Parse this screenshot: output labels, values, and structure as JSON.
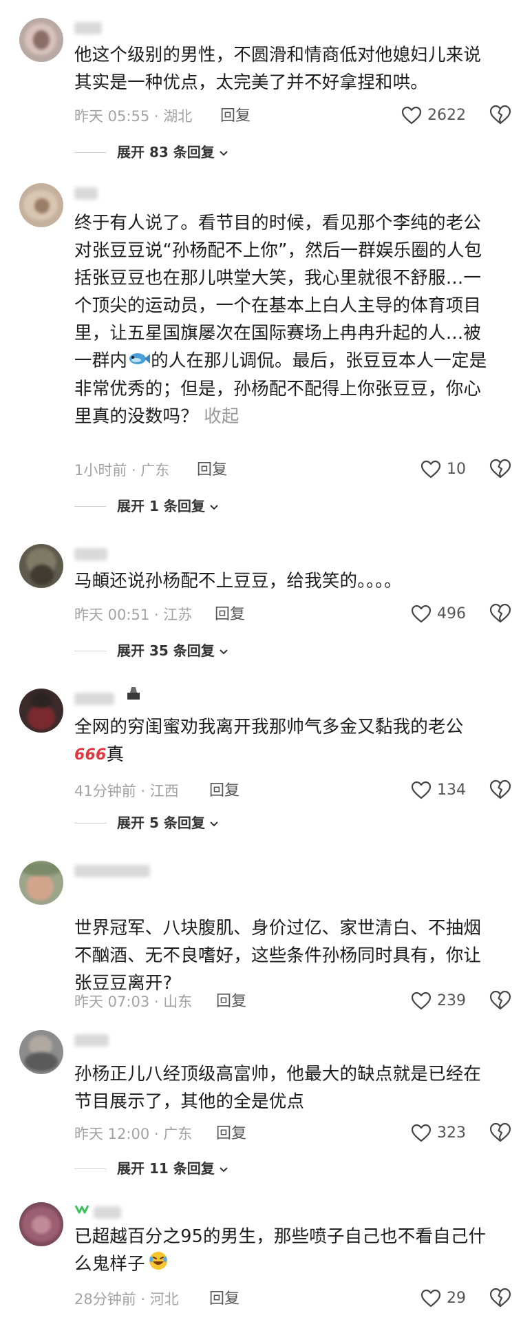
{
  "comments": [
    {
      "text": "他这个级别的男性，不圆滑和情商低对他媳妇儿来说其实是一种优点，太完美了并不好拿捏和哄。",
      "lines": [
        "他这个级别的男性，不圆滑和情商低对他媳妇儿来说",
        "其实是一种优点，太完美了并不好拿捏和哄。"
      ],
      "time": "昨天 05:55 · 湖北",
      "reply": "回复",
      "likes": "2622",
      "expand": "展开 83 条回复"
    },
    {
      "lines": [
        "终于有人说了。看节目的时候，看见那个李纯的老公",
        "对张豆豆说“孙杨配不上你”，然后一群娱乐圈的人包",
        "括张豆豆也在那儿哄堂大笑，我心里就很不舒服…一",
        "个顶尖的运动员，一个在基本上白人主导的体育项目",
        "里，让五星国旗屡次在国际赛场上冉冉升起的人…被",
        "一群内",
        "的人在那儿调侃。最后，张豆豆本人一定是",
        "非常优秀的；但是，孙杨配不配得上你张豆豆，你心",
        "里真的没数吗？"
      ],
      "collapse": "收起",
      "time": "1小时前 · 广东",
      "reply": "回复",
      "likes": "10",
      "expand": "展开 1 条回复"
    },
    {
      "lines": [
        "马頔还说孙杨配不上豆豆，给我笑的。。。。"
      ],
      "time": "昨天 00:51 · 江苏",
      "reply": "回复",
      "likes": "496",
      "expand": "展开 35 条回复"
    },
    {
      "lines": [
        "全网的穷闺蜜劝我离开我那帅气多金又黏我的老公",
        "真"
      ],
      "emoji": "666",
      "time": "41分钟前 · 江西",
      "reply": "回复",
      "likes": "134",
      "expand": "展开 5 条回复"
    },
    {
      "lines": [
        "世界冠军、八块腹肌、身价过亿、家世清白、不抽烟",
        "不酗酒、无不良嗜好，这些条件孙杨同时具有，你让",
        "张豆豆离开?"
      ],
      "time": "昨天 07:03 · 山东",
      "reply": "回复",
      "likes": "239"
    },
    {
      "lines": [
        "孙杨正儿八经顶级高富帅，他最大的缺点就是已经在",
        "节目展示了，其他的全是优点"
      ],
      "time": "昨天 12:00 · 广东",
      "reply": "回复",
      "likes": "323",
      "expand": "展开 11 条回复"
    },
    {
      "lines": [
        "已超越百分之95的男生，那些喷子自己也不看自己什",
        "么鬼样子"
      ],
      "time": "28分钟前 · 河北",
      "reply": "回复",
      "likes": "29"
    }
  ],
  "colors": {
    "text": "#1c1c1c",
    "meta": "#a3a3a3",
    "reply": "#555555",
    "collapse": "#9a9a9a",
    "expand": "#333333"
  },
  "icons": {
    "like": "heart-outline-icon",
    "dislike": "broken-heart-icon",
    "expand": "chevron-down-icon"
  }
}
